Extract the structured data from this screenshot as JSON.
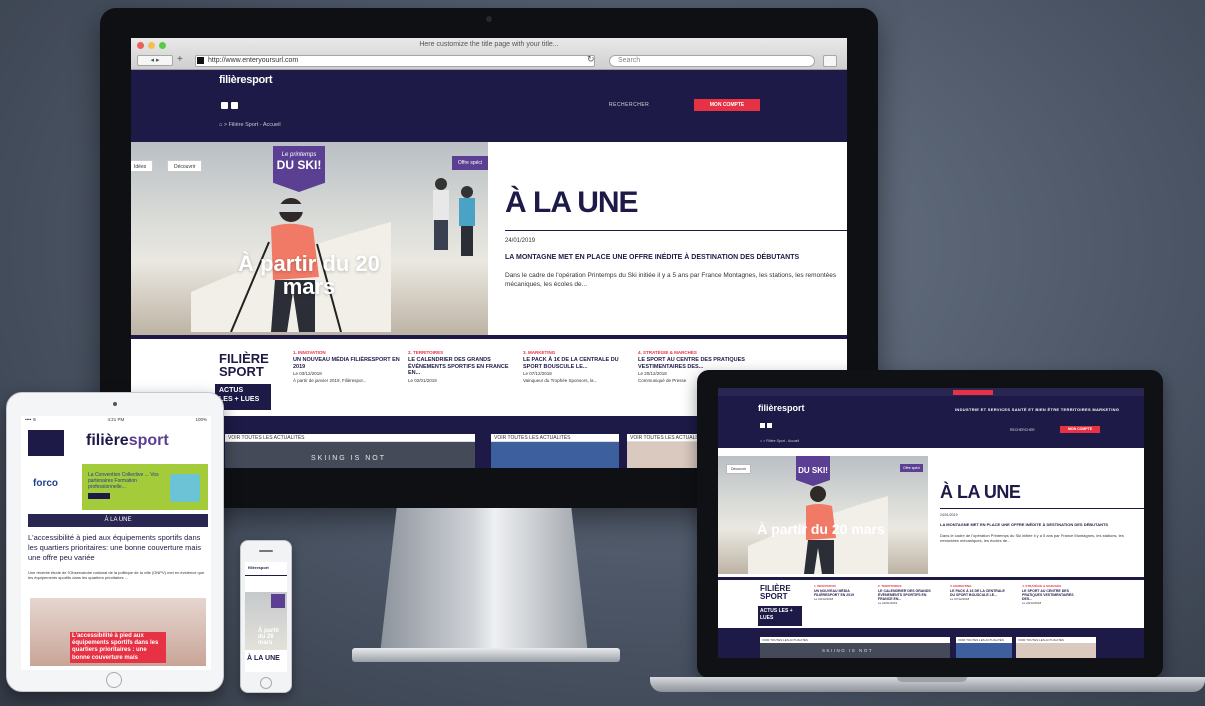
{
  "desktop": {
    "browser": {
      "window_title": "Here customize the title page with your title...",
      "url": "http://www.enteryoursurl.com",
      "search_placeholder": "Search",
      "nav_buttons": "◂ ▸"
    },
    "site": {
      "logo": "filièresport",
      "search_label": "RECHERCHER",
      "account_button": "MON COMPTE",
      "breadcrumb": "⌂  >  Filière Sport - Accueil"
    },
    "hero": {
      "tag_left": "Idées",
      "tag_discover": "Découvrir",
      "badge_line1": "Le printemps",
      "badge_line2": "DU SKI!",
      "caption": "À partir du 20 mars",
      "offer_tag": "Offre spéci"
    },
    "a_la_une": {
      "title": "À LA UNE",
      "date": "24/01/2019",
      "headline": "LA MONTAGNE MET EN PLACE UNE OFFRE INÉDITE À DESTINATION DES DÉBUTANTS",
      "excerpt": "Dans le cadre de l'opération Printemps du Ski initiée il y a 5 ans par France Montagnes, les stations, les remontées mécaniques, les écoles de..."
    },
    "news": {
      "brand_line1": "FILIÈRE",
      "brand_line2": "SPORT",
      "actus_line1": "ACTUS",
      "actus_line2": "LES + LUES",
      "items": [
        {
          "category": "1. INNOVATION",
          "headline": "UN NOUVEAU MÉDIA FILIÈRESPORT EN 2019",
          "date": "Le 03/12/2018",
          "excerpt": "À partir de janvier 2019, Filièrespor..."
        },
        {
          "category": "2. TERRITOIRES",
          "headline": "LE CALENDRIER DES GRANDS ÉVÉNEMENTS SPORTIFS EN FRANCE EN...",
          "date": "Le 02/01/2019",
          "excerpt": ""
        },
        {
          "category": "3. MARKETING",
          "headline": "LE PACK À 1€ DE LA CENTRALE DU SPORT BOUSCULE LE...",
          "date": "Le 07/12/2018",
          "excerpt": "Vainqueur du Trophée Sponsors, la..."
        },
        {
          "category": "4. STRATÉGIE & MARCHÉS",
          "headline": "LE SPORT AU CENTRE DES PRATIQUES VESTIMENTAIRES DES...",
          "date": "Le 20/12/2018",
          "excerpt": "Communiqué de Presse"
        }
      ],
      "see_all": "VOIR TOUTES LES ACTUALITÉS",
      "skiing_text": "SKIING IS NOT"
    }
  },
  "tablet": {
    "status_left": "•••• ≋",
    "status_time": "4:21 PM",
    "status_right": "100%",
    "logo_prefix": "filière",
    "logo_suffix": "sport",
    "ad_brand": "forco",
    "ad_text": "La Convention Collective ... Vos partenaires Formation professionnelle...",
    "section_bar": "À LA UNE",
    "headline": "L'accessibilité à pied aux équipements sportifs dans les quartiers prioritaires: une bonne couverture mais une offre peu variée",
    "body": "Une récente étude de l'Observatoire national de la politique de la ville (ONPV) met en évidence que les équipements sportifs dans les quartiers prioritaires ...",
    "image_overlay": "L'accessibilité à pied aux équipements sportifs dans les quartiers prioritaires : une bonne couverture mais"
  },
  "phone": {
    "logo": "filièresport",
    "caption": "À partir du 20 mars",
    "title": "À LA UNE"
  },
  "laptop": {
    "logo": "filièresport",
    "menu": "INDUSTRIE ET SERVICES   SANTÉ ET BIEN ÊTRE   TERRITOIRES   MARKETING",
    "search_label": "RECHERCHER",
    "account_button": "MON COMPTE",
    "breadcrumb": "⌂ > Filière Sport - Accueil",
    "discover": "Découvrir",
    "offer": "Offre spéci",
    "badge": "DU SKI!",
    "caption": "À partir du 20 mars",
    "une_title": "À LA UNE",
    "une_date": "24/01/2019",
    "une_headline": "LA MONTAGNE MET EN PLACE UNE OFFRE INÉDITE À DESTINATION DES DÉBUTANTS",
    "une_text": "Dans le cadre de l'opération Printemps du Ski initiée il y a 5 ans par France Montagnes, les stations, les remontées mécaniques, les écoles de...",
    "brand_line1": "FILIÈRE",
    "brand_line2": "SPORT",
    "actus": "ACTUS LES + LUES",
    "skiing_text": "SKIING IS NOT"
  }
}
